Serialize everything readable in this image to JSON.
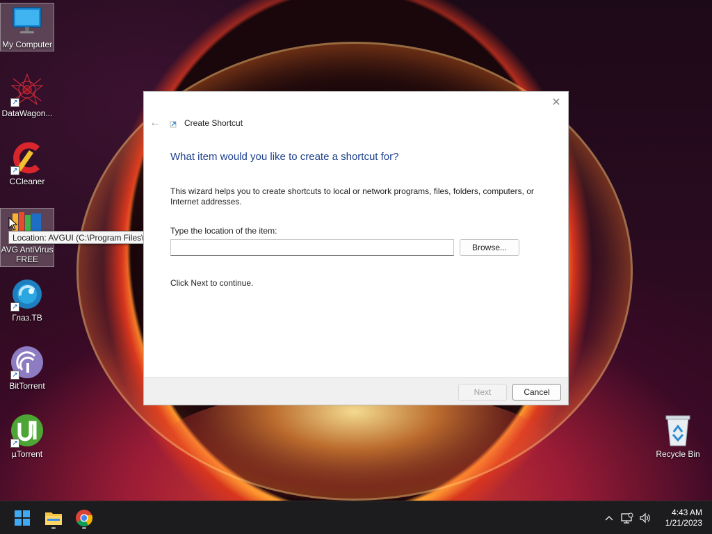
{
  "desktop": {
    "icons": [
      {
        "label": "My Computer"
      },
      {
        "label": "DataWagon..."
      },
      {
        "label": "CCleaner"
      },
      {
        "label": "AVG AntiVirus FREE"
      },
      {
        "label": "Глаз.ТВ"
      },
      {
        "label": "BitTorrent"
      },
      {
        "label": "µTorrent"
      },
      {
        "label": "Recycle Bin"
      }
    ],
    "tooltip": "Location: AVGUI (C:\\Program Files\\AVG\\Antivirus)"
  },
  "dialog": {
    "title": "Create Shortcut",
    "heading": "What item would you like to create a shortcut for?",
    "description": "This wizard helps you to create shortcuts to local or network programs, files, folders, computers, or Internet addresses.",
    "location_label": "Type the location of the item:",
    "location_value": "",
    "browse_label": "Browse...",
    "continue_text": "Click Next to continue.",
    "next_label": "Next",
    "cancel_label": "Cancel",
    "close_glyph": "✕",
    "back_glyph": "←"
  },
  "taskbar": {
    "apps": [
      {
        "icon": "windows-start-icon"
      },
      {
        "icon": "file-explorer-icon"
      },
      {
        "icon": "chrome-icon"
      }
    ],
    "tray": {
      "chevron": "^",
      "time": "4:43 AM",
      "date": "1/21/2023"
    }
  },
  "colors": {
    "accent_heading": "#1d3f8c",
    "taskbar": "#1c1c1e"
  }
}
